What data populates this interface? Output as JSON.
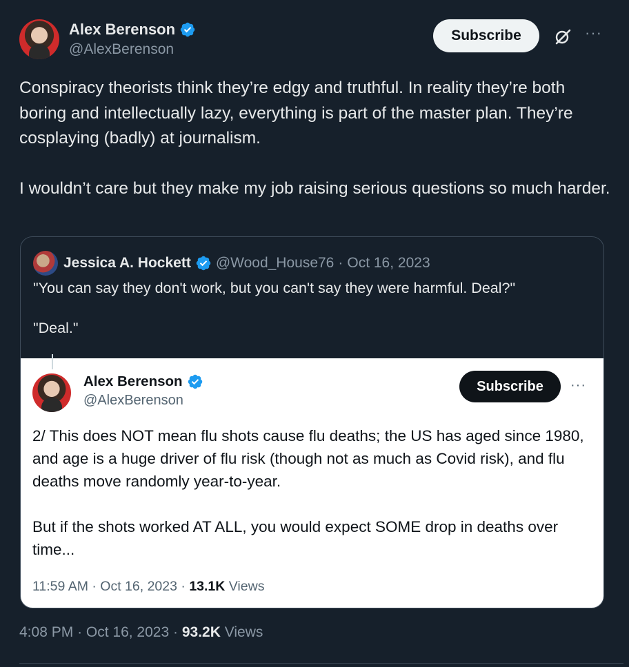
{
  "tweet": {
    "author": {
      "name": "Alex Berenson",
      "handle": "@AlexBerenson"
    },
    "subscribe_label": "Subscribe",
    "paragraphs": [
      "Conspiracy theorists think they’re edgy and truthful. In reality they’re both boring and intellectually lazy, everything is part of the master plan. They’re cosplaying (badly) at journalism.",
      "I wouldn’t care but they make my job raising serious questions so much harder."
    ],
    "time": "4:08 PM",
    "date": "Oct 16, 2023",
    "views_count": "93.2K",
    "views_label": "Views"
  },
  "quote": {
    "author": {
      "name": "Jessica A. Hockett",
      "handle": "@Wood_House76",
      "date": "Oct 16, 2023"
    },
    "paragraphs": [
      "\"You can say they don't work, but you can't say they were harmful. Deal?\"",
      "\"Deal.\""
    ]
  },
  "inner": {
    "author": {
      "name": "Alex Berenson",
      "handle": "@AlexBerenson"
    },
    "subscribe_label": "Subscribe",
    "paragraphs": [
      "2/ This does NOT mean flu shots cause flu deaths; the US has aged since 1980, and age is a huge driver of flu risk (though not as much as Covid risk), and flu deaths move randomly year-to-year.",
      "But if the shots worked AT ALL, you would expect SOME drop in deaths over time..."
    ],
    "time": "11:59 AM",
    "date": "Oct 16, 2023",
    "views_count": "13.1K",
    "views_label": "Views"
  },
  "separator": "·",
  "icons": {
    "verified": "verified-badge-icon",
    "grok": "grok-icon",
    "more": "more-icon"
  },
  "colors": {
    "background": "#16202b",
    "verified_blue": "#1d9bf0",
    "secondary_text": "#8b98a5"
  }
}
